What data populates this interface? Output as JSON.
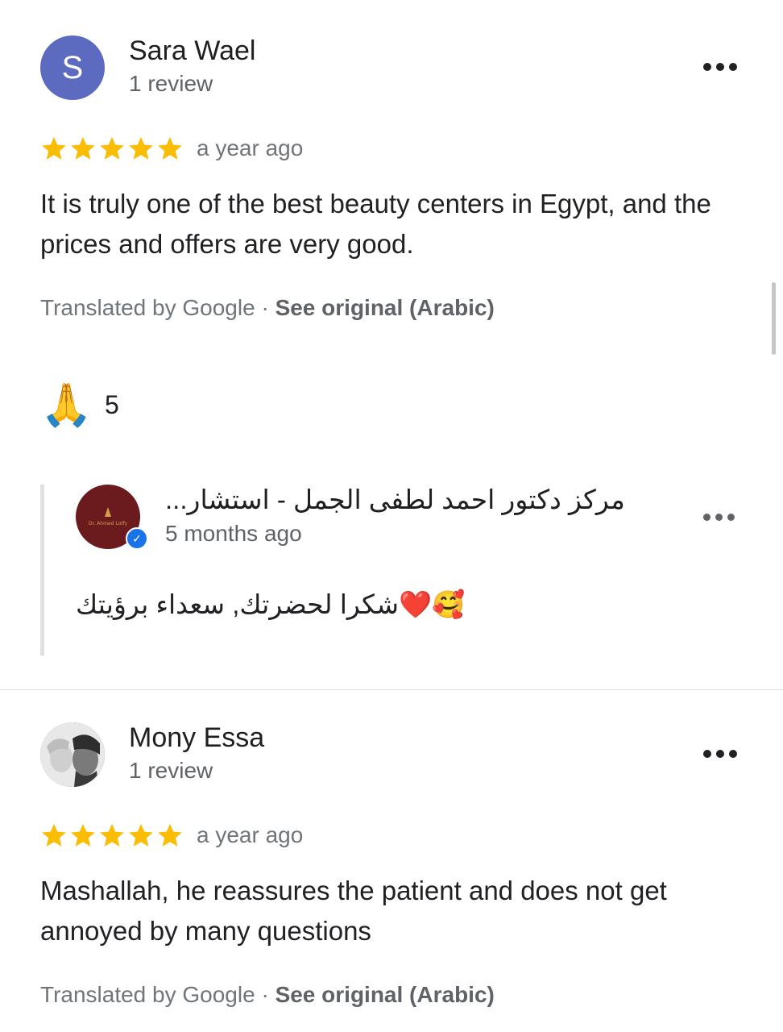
{
  "reviews": [
    {
      "avatar_letter": "S",
      "name": "Sara Wael",
      "review_count": "1 review",
      "rating": 5,
      "time": "a year ago",
      "text": "It is truly one of the best beauty centers in Egypt, and the prices and offers are very good.",
      "translated_by": "Translated by Google · ",
      "see_original": "See original (Arabic)",
      "reaction_emoji": "🙏",
      "reaction_count": "5",
      "owner_reply": {
        "name": "مركز دكتور احمد لطفى الجمل - استشار...",
        "time": "5 months ago",
        "text": "🥰❤️شكرا لحضرتك, سعداء برؤيتك",
        "logo_text": "Dr. Ahmed Lotfy"
      }
    },
    {
      "name": "Mony Essa",
      "review_count": "1 review",
      "rating": 5,
      "time": "a year ago",
      "text": "Mashallah, he reassures the patient and does not get annoyed by many questions",
      "translated_by": "Translated by Google · ",
      "see_original": "See original (Arabic)"
    }
  ],
  "colors": {
    "star": "#fbbc04",
    "avatar_bg": "#5c6bc0",
    "owner_avatar_bg": "#6b1b1e",
    "verified": "#1a73e8"
  },
  "icons": {
    "more": "more-horizontal-icon",
    "star": "star-icon",
    "verified": "verified-check-icon"
  }
}
